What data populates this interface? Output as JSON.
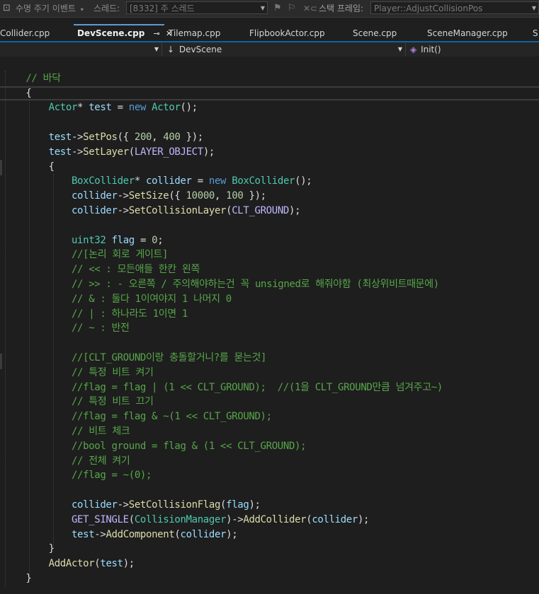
{
  "debug_bar": {
    "event_label": "수명 주기 이벤트",
    "thread_label": "스레드:",
    "thread_value": "[8332] 주 스레드",
    "stackframe_label": "스택 프레임:",
    "stackframe_value": "Player::AdjustCollisionPos"
  },
  "tabs": [
    {
      "label": "Collider.cpp"
    },
    {
      "label": "DevScene.cpp",
      "active": true,
      "pin": "⊸",
      "close": "✕"
    },
    {
      "label": "Tilemap.cpp"
    },
    {
      "label": "FlipbookActor.cpp"
    },
    {
      "label": "Scene.cpp"
    },
    {
      "label": "SceneManager.cpp"
    },
    {
      "label": "S"
    }
  ],
  "nav": {
    "scope_value": "DevScene",
    "scope_arrow": "↓",
    "member_value": "Init()"
  },
  "code": {
    "lines": [
      "",
      "    // 바닥",
      "    {",
      "        Actor* test = new Actor();",
      "",
      "        test->SetPos({ 200, 400 });",
      "        test->SetLayer(LAYER_OBJECT);",
      "        {",
      "            BoxCollider* collider = new BoxCollider();",
      "            collider->SetSize({ 10000, 100 });",
      "            collider->SetCollisionLayer(CLT_GROUND);",
      "",
      "            uint32 flag = 0;",
      "            //[논리 회로 게이트]",
      "            // << : 모든애들 한칸 왼쪽",
      "            // >> : - 오른쪽 / 주의해야하는건 꼭 unsigned로 해줘야함 (최상위비트때문에)",
      "            // & : 둘다 1이여야지 1 나머지 0",
      "            // | : 하나라도 1이면 1",
      "            // ~ : 반전",
      "",
      "            //[CLT_GROUND이랑 충돌할거니?를 묻는것]",
      "            // 특정 비트 켜기",
      "            //flag = flag | (1 << CLT_GROUND);  //(1을 CLT_GROUND만큼 넘겨주고~)",
      "            // 특정 비트 끄기",
      "            //flag = flag & ~(1 << CLT_GROUND);",
      "            // 비트 체크",
      "            //bool ground = flag & (1 << CLT_GROUND);",
      "            // 전체 켜기",
      "            //flag = ~(0);",
      "",
      "            collider->SetCollisionFlag(flag);",
      "            GET_SINGLE(CollisionManager)->AddCollider(collider);",
      "            test->AddComponent(collider);",
      "        }",
      "        AddActor(test);",
      "    }"
    ]
  }
}
